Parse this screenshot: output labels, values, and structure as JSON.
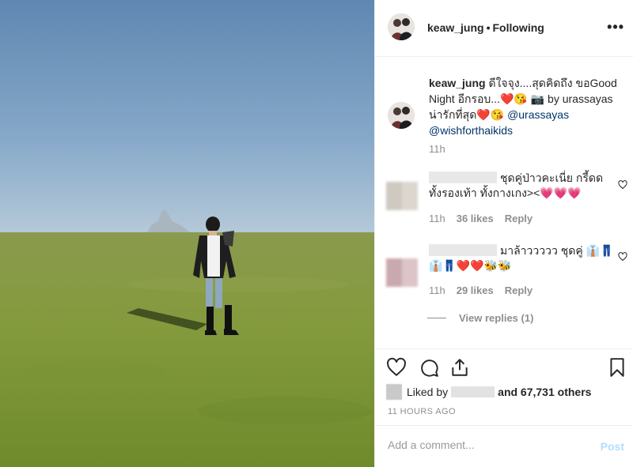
{
  "colors": {
    "link": "#003569",
    "muted": "#8e8e8e",
    "post_disabled": "#b2dffc",
    "heart_red": "#ed4956"
  },
  "photo": {
    "icon": "photo-field-person"
  },
  "header": {
    "username": "keaw_jung",
    "separator": "•",
    "follow_status": "Following",
    "more_icon": "more-horizontal-icon",
    "more_glyph": "•••"
  },
  "caption": {
    "username": "keaw_jung",
    "text_1": " ดีใจจุง....สุดคิดถึง ขอGood Night อีกรอบ...",
    "emoji_1": "❤️😘 📷",
    "text_2": " by urassayas น่ารักที่สุด",
    "emoji_2": "❤️😘 ",
    "mention_1": "@urassayas",
    "mention_2": "@wishforthaikids",
    "time": "11h"
  },
  "comments": [
    {
      "text": "ชุดคู่ป่าวคะเนี่ย กรี้ดดทั้งรองเท้า ทั้งกางเกง><💗💗💗",
      "time": "11h",
      "likes": "36 likes",
      "reply": "Reply"
    },
    {
      "text": "มาล้าววววว ชุดคู่ 👔👖👔👖❤️❤️🐝🐝",
      "time": "11h",
      "likes": "29 likes",
      "reply": "Reply"
    }
  ],
  "view_replies": "View replies (1)",
  "actions": {
    "like_icon": "heart-icon",
    "comment_icon": "comment-icon",
    "share_icon": "share-icon",
    "save_icon": "bookmark-icon",
    "liked_by": "Liked by",
    "and_others": "and 67,731 others",
    "time_ago": "11 HOURS AGO"
  },
  "add_comment": {
    "placeholder": "Add a comment...",
    "post_label": "Post"
  }
}
